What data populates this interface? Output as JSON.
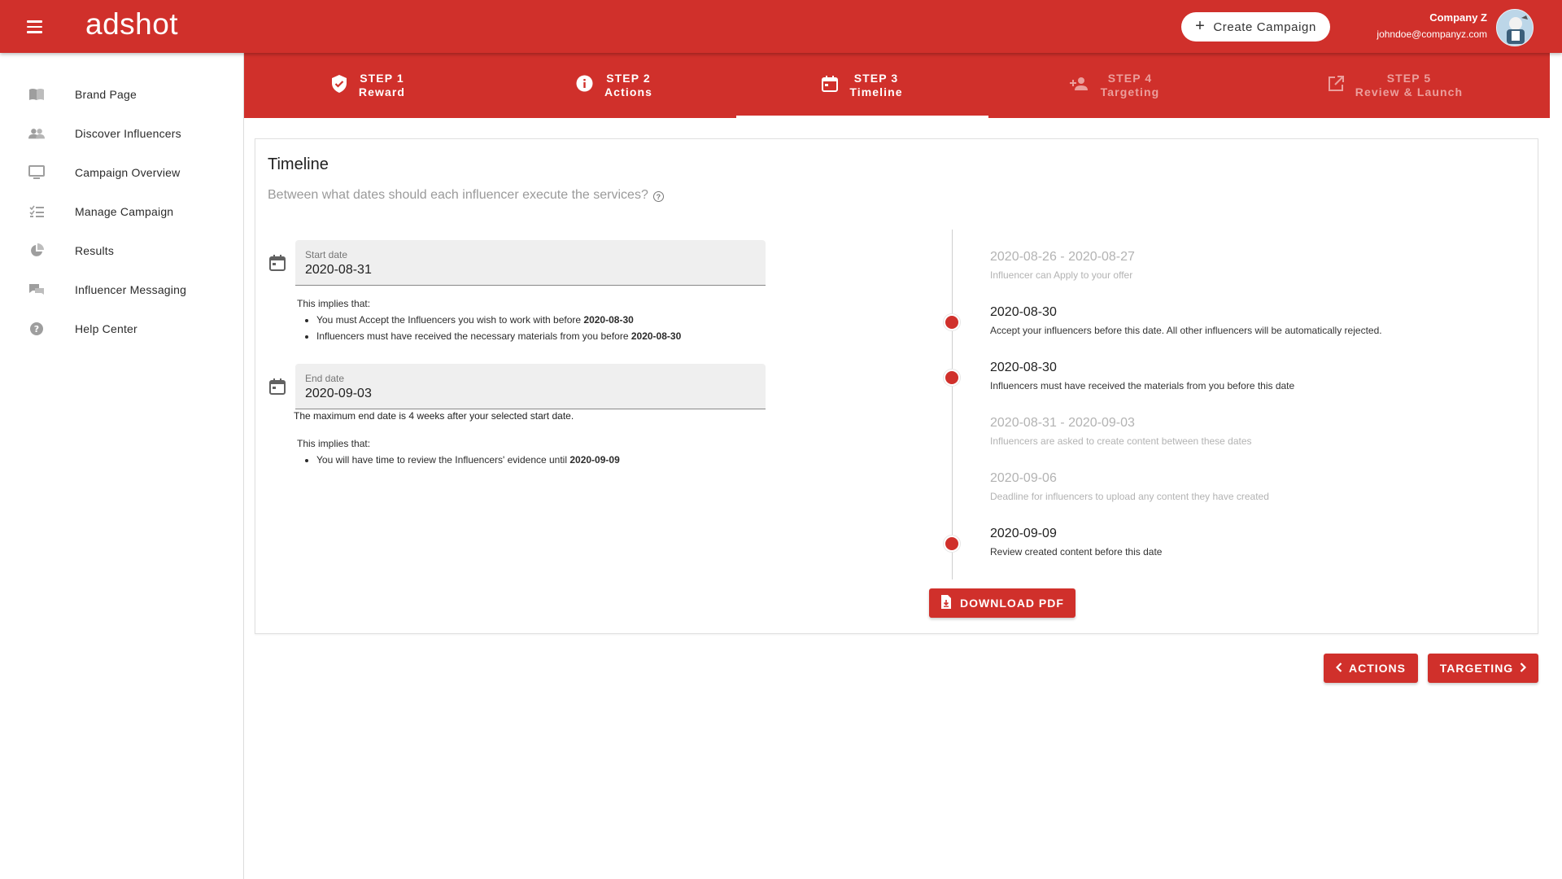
{
  "app": {
    "logo": "adshot"
  },
  "topbar": {
    "create_campaign_label": "Create Campaign",
    "company": "Company Z",
    "email": "johndoe@companyz.com"
  },
  "sidebar": {
    "items": [
      {
        "label": "Brand Page",
        "icon": "book-icon"
      },
      {
        "label": "Discover Influencers",
        "icon": "people-icon"
      },
      {
        "label": "Campaign Overview",
        "icon": "monitor-icon"
      },
      {
        "label": "Manage Campaign",
        "icon": "checklist-icon"
      },
      {
        "label": "Results",
        "icon": "pie-chart-icon"
      },
      {
        "label": "Influencer Messaging",
        "icon": "chat-icon"
      },
      {
        "label": "Help Center",
        "icon": "help-icon"
      }
    ]
  },
  "stepper": {
    "steps": [
      {
        "step": "STEP 1",
        "name": "Reward",
        "icon": "shield-check-icon",
        "state": "done"
      },
      {
        "step": "STEP 2",
        "name": "Actions",
        "icon": "info-icon",
        "state": "done"
      },
      {
        "step": "STEP 3",
        "name": "Timeline",
        "icon": "calendar-icon",
        "state": "active"
      },
      {
        "step": "STEP 4",
        "name": "Targeting",
        "icon": "person-add-icon",
        "state": "upcoming"
      },
      {
        "step": "STEP 5",
        "name": "Review & Launch",
        "icon": "open-external-icon",
        "state": "upcoming"
      }
    ]
  },
  "timeline_card": {
    "title": "Timeline",
    "subtitle": "Between what dates should each influencer execute the services?",
    "start": {
      "label": "Start date",
      "value": "2020-08-31",
      "implies_heading": "This implies that:",
      "implies": [
        {
          "text": "You must Accept the Influencers you wish to work with before ",
          "bold": "2020-08-30"
        },
        {
          "text": "Influencers must have received the necessary materials from you before ",
          "bold": "2020-08-30"
        }
      ]
    },
    "end": {
      "label": "End date",
      "value": "2020-09-03",
      "note": "The maximum end date is 4 weeks after your selected start date.",
      "implies_heading": "This implies that:",
      "implies": [
        {
          "text": "You will have time to review the Influencers' evidence until ",
          "bold": "2020-09-09"
        }
      ]
    },
    "timeline": [
      {
        "date": "2020-08-26 - 2020-08-27",
        "text": "Influencer can Apply to your offer",
        "muted": true
      },
      {
        "date": "2020-08-30",
        "text": "Accept your influencers before this date. All other influencers will be automatically rejected.",
        "muted": false
      },
      {
        "date": "2020-08-30",
        "text": "Influencers must have received the materials from you before this date",
        "muted": false
      },
      {
        "date": "2020-08-31 - 2020-09-03",
        "text": "Influencers are asked to create content between these dates",
        "muted": true
      },
      {
        "date": "2020-09-06",
        "text": "Deadline for influencers to upload any content they have created",
        "muted": true
      },
      {
        "date": "2020-09-09",
        "text": "Review created content before this date",
        "muted": false
      }
    ],
    "download_label": "DOWNLOAD PDF"
  },
  "footer_nav": {
    "back_label": "ACTIONS",
    "next_label": "TARGETING"
  },
  "colors": {
    "brand": "#d0302b",
    "muted_text": "#b3b3b3",
    "field_bg": "#efefef"
  }
}
